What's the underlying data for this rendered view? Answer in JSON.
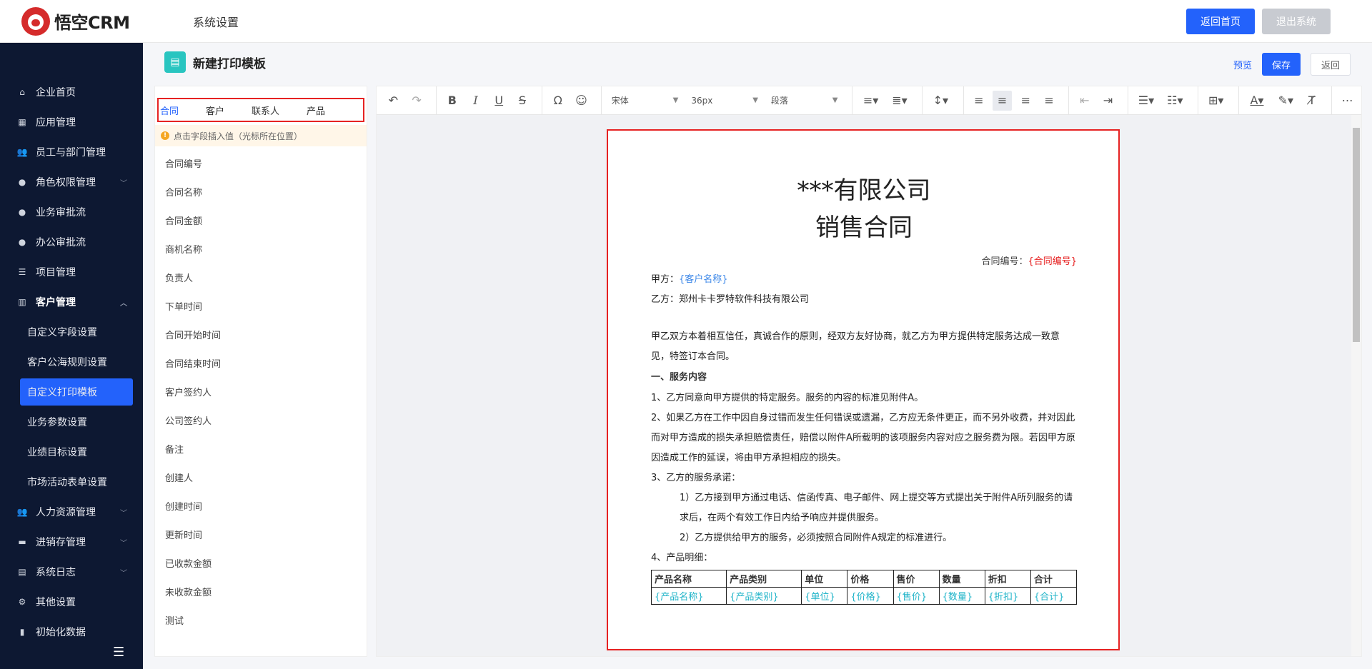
{
  "app": {
    "logo_text": "悟空CRM",
    "section_title": "系统设置"
  },
  "top_actions": {
    "home": "返回首页",
    "logout": "退出系统"
  },
  "sidebar": {
    "items": [
      {
        "label": "企业首页",
        "icon": "home-icon",
        "chevron": false
      },
      {
        "label": "应用管理",
        "icon": "grid-icon",
        "chevron": false
      },
      {
        "label": "员工与部门管理",
        "icon": "users-icon",
        "chevron": false
      },
      {
        "label": "角色权限管理",
        "icon": "user-icon",
        "chevron": true
      },
      {
        "label": "业务审批流",
        "icon": "user-icon",
        "chevron": false
      },
      {
        "label": "办公审批流",
        "icon": "user-icon",
        "chevron": false
      },
      {
        "label": "项目管理",
        "icon": "list-icon",
        "chevron": false
      },
      {
        "label": "客户管理",
        "icon": "building-icon",
        "chevron": true
      }
    ],
    "sub_items": [
      "自定义字段设置",
      "客户公海规则设置",
      "自定义打印模板",
      "业务参数设置",
      "业绩目标设置",
      "市场活动表单设置"
    ],
    "active_sub": 2,
    "items_after": [
      {
        "label": "人力资源管理",
        "icon": "users-icon",
        "chevron": true
      },
      {
        "label": "进销存管理",
        "icon": "truck-icon",
        "chevron": true
      },
      {
        "label": "系统日志",
        "icon": "doc-icon",
        "chevron": true
      },
      {
        "label": "其他设置",
        "icon": "gear-icon",
        "chevron": false
      },
      {
        "label": "初始化数据",
        "icon": "chart-icon",
        "chevron": false
      }
    ]
  },
  "page": {
    "title": "新建打印模板",
    "preview": "预览",
    "save": "保存",
    "back": "返回"
  },
  "fields": {
    "tabs": [
      "合同",
      "客户",
      "联系人",
      "产品"
    ],
    "active_tab": 0,
    "tip": "点击字段插入值（光标所在位置）",
    "items": [
      "合同编号",
      "合同名称",
      "合同金额",
      "商机名称",
      "负责人",
      "下单时间",
      "合同开始时间",
      "合同结束时间",
      "客户签约人",
      "公司签约人",
      "备注",
      "创建人",
      "创建时间",
      "更新时间",
      "已收款金额",
      "未收款金额",
      "测试"
    ]
  },
  "toolbar": {
    "font_family": "宋体",
    "font_size": "36px",
    "paragraph": "段落"
  },
  "doc": {
    "title1": "***有限公司",
    "title2": "销售合同",
    "contract_no_label": "合同编号：",
    "contract_no_value": "{合同编号}",
    "party_a_label": "甲方：",
    "party_a_value": "{客户名称}",
    "party_b": "乙方：郑州卡卡罗特软件科技有限公司",
    "intro": "甲乙双方本着相互信任，真诚合作的原则，经双方友好协商，就乙方为甲方提供特定服务达成一致意见，特签订本合同。",
    "section1": "一、服务内容",
    "p1": "1、乙方同意向甲方提供的特定服务。服务的内容的标准见附件A。",
    "p2": "2、如果乙方在工作中因自身过错而发生任何错误或遗漏，乙方应无条件更正，而不另外收费，并对因此而对甲方造成的损失承担赔偿责任，赔偿以附件A所载明的该项服务内容对应之服务费为限。若因甲方原因造成工作的延误，将由甲方承担相应的损失。",
    "p3": "3、乙方的服务承诺：",
    "p3_1": "1）乙方接到甲方通过电话、信函传真、电子邮件、网上提交等方式提出关于附件A所列服务的请求后，在两个有效工作日内给予响应并提供服务。",
    "p3_2": "2）乙方提供给甲方的服务，必须按照合同附件A规定的标准进行。",
    "p4": "4、产品明细：",
    "table_headers": [
      "产品名称",
      "产品类别",
      "单位",
      "价格",
      "售价",
      "数量",
      "折扣",
      "合计"
    ],
    "table_values": [
      "{产品名称}",
      "{产品类别}",
      "{单位}",
      "{价格}",
      "{售价}",
      "{数量}",
      "{折扣}",
      "{合计}"
    ]
  }
}
